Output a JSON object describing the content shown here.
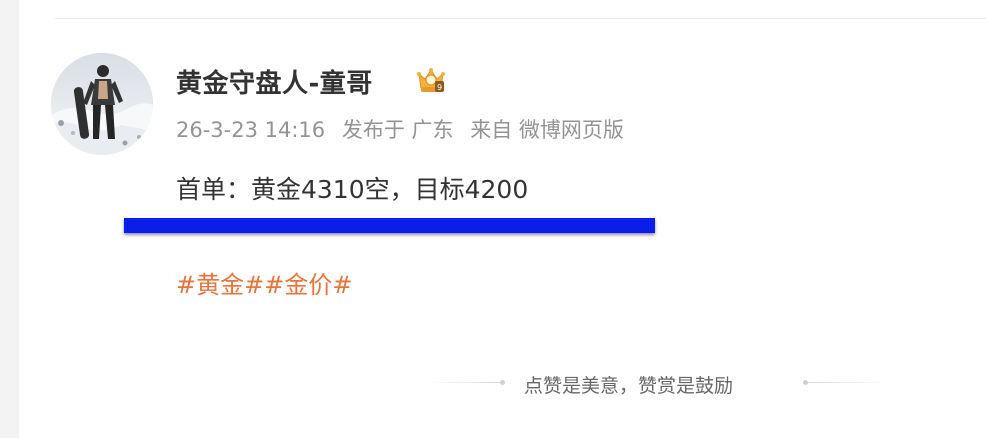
{
  "post": {
    "author_name": "黄金守盘人-童哥",
    "avatar_icon": "avatar-photo-snowboarder",
    "badge_icon": "vip-crown-badge-icon",
    "meta": {
      "datetime": "26-3-23 14:16",
      "location": "发布于 广东",
      "source": "来自 微博网页版"
    },
    "text": "首单：黄金4310空，目标4200",
    "topics": [
      "#黄金#",
      "#金价#"
    ]
  },
  "footer": {
    "reward_prompt": "点赞是美意，赞赏是鼓励"
  },
  "colors": {
    "author": "#333333",
    "meta": "#939393",
    "topic": "#e8733b",
    "highlight_bar": "#0a1eeb",
    "footer_text": "#666666"
  }
}
